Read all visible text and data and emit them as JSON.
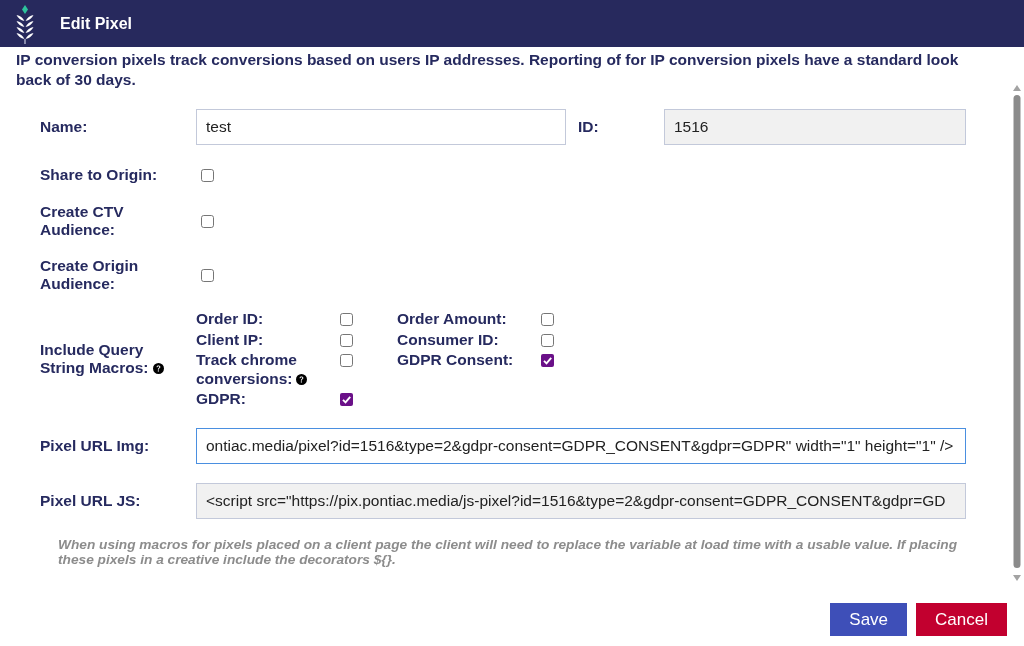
{
  "header": {
    "title": "Edit Pixel"
  },
  "intro": "IP conversion pixels track conversions based on users IP addresses. Reporting of for IP conversion pixels have a standard look back of 30 days.",
  "name_field": {
    "label": "Name:",
    "value": "test",
    "disabled": false,
    "focused": false
  },
  "id_field": {
    "label": "ID:",
    "value": "1516",
    "disabled": true,
    "focused": false
  },
  "options": [
    {
      "label": "Share to Origin:",
      "checked": false
    },
    {
      "label": "Create CTV Audience:",
      "checked": false
    },
    {
      "label": "Create Origin Audience:",
      "checked": false
    }
  ],
  "query_macros": {
    "label": "Include Query String Macros:",
    "help": true,
    "columns": [
      {
        "options": [
          {
            "label": "Order ID:",
            "checked": false,
            "help": false
          },
          {
            "label": "Client IP:",
            "checked": false,
            "help": false
          },
          {
            "label": "Track chrome conversions:",
            "checked": false,
            "help": true
          },
          {
            "label": "GDPR:",
            "checked": true,
            "help": false
          }
        ]
      },
      {
        "options": [
          {
            "label": "Order Amount:",
            "checked": false,
            "help": false
          },
          {
            "label": "Consumer ID:",
            "checked": false,
            "help": false
          },
          {
            "label": "GDPR Consent:",
            "checked": true,
            "help": false
          }
        ]
      }
    ]
  },
  "url_fields": [
    {
      "label": "Pixel URL Img:",
      "value": "ontiac.media/pixel?id=1516&type=2&gdpr-consent=GDPR_CONSENT&gdpr=GDPR\" width=\"1\" height=\"1\" />",
      "disabled": false,
      "focused": true
    },
    {
      "label": "Pixel URL JS:",
      "value": "<script src=\"https://pix.pontiac.media/js-pixel?id=1516&type=2&gdpr-consent=GDPR_CONSENT&gdpr=GD",
      "disabled": true,
      "focused": false
    }
  ],
  "note": "When using macros for pixels placed on a client page the client will need to replace the variable at load time with a usable value. If placing these pixels in a creative include the decorators ${}.",
  "buttons": [
    {
      "label": "Save",
      "kind": "primary"
    },
    {
      "label": "Cancel",
      "kind": "danger"
    }
  ]
}
